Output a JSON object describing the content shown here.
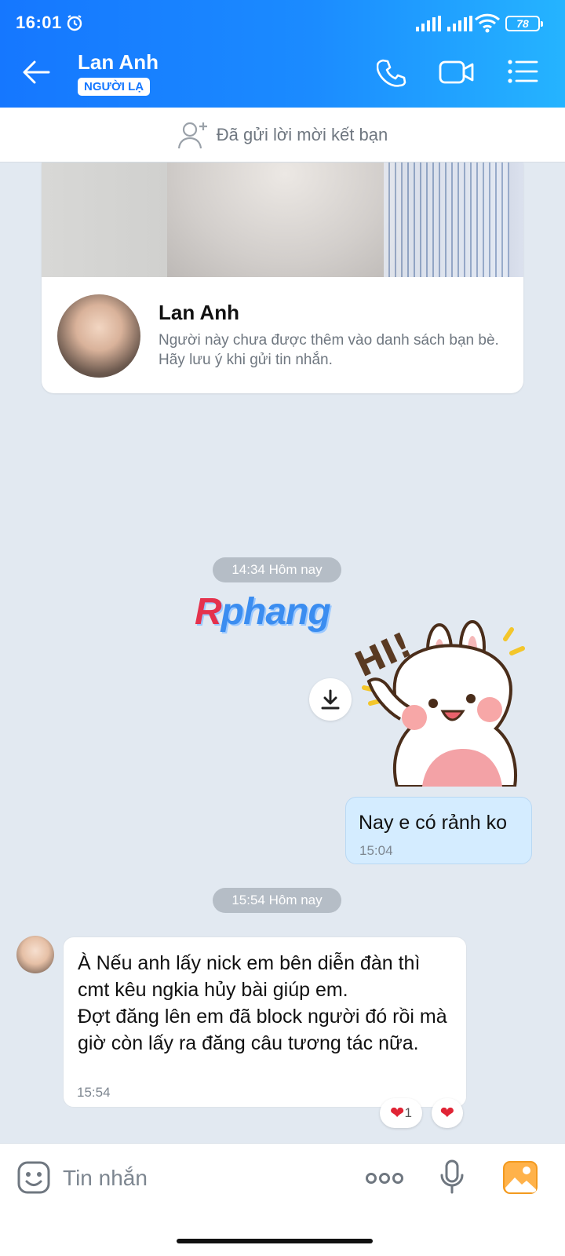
{
  "status_bar": {
    "time": "16:01",
    "battery": "78",
    "icons": [
      "alarm-icon",
      "signal-icon",
      "signal-icon",
      "wifi-icon",
      "battery-icon"
    ]
  },
  "header": {
    "title": "Lan Anh",
    "badge": "NGƯỜI LẠ",
    "icons": [
      "back-arrow-icon",
      "phone-icon",
      "video-call-icon",
      "menu-list-icon"
    ]
  },
  "banner": {
    "text": "Đã gửi lời mời kết bạn",
    "icon": "add-friend-icon"
  },
  "profile_card": {
    "name": "Lan Anh",
    "description": "Người này chưa được thêm vào danh sách bạn bè. Hãy lưu ý khi gửi tin nhắn."
  },
  "messages": {
    "time_pill_1": "14:34 Hôm nay",
    "watermark": {
      "part1": "R",
      "part2": "phang"
    },
    "sticker_text": "HI!",
    "outgoing": {
      "text": "Nay e có rảnh ko",
      "time": "15:04"
    },
    "time_pill_2": "15:54 Hôm nay",
    "incoming": {
      "text": "À Nếu anh lấy nick em bên diễn đàn thì cmt kêu ngkia hủy bài giúp em.\nĐợt đăng lên em đã block người đó rồi mà giờ còn lấy ra đăng câu tương tác nữa.",
      "time": "15:54"
    },
    "reaction_count": "1",
    "reaction_heart": "❤",
    "reaction_button_heart": "❤"
  },
  "input_bar": {
    "placeholder": "Tin nhắn",
    "icons": [
      "emoji-icon",
      "more-icon",
      "microphone-icon",
      "photo-icon"
    ]
  },
  "colors": {
    "header_start": "#1577ff",
    "header_end": "#25b4ff",
    "chat_bg": "#e2e9f1",
    "outgoing_bubble": "#d4ecff",
    "heart": "#e02435"
  }
}
